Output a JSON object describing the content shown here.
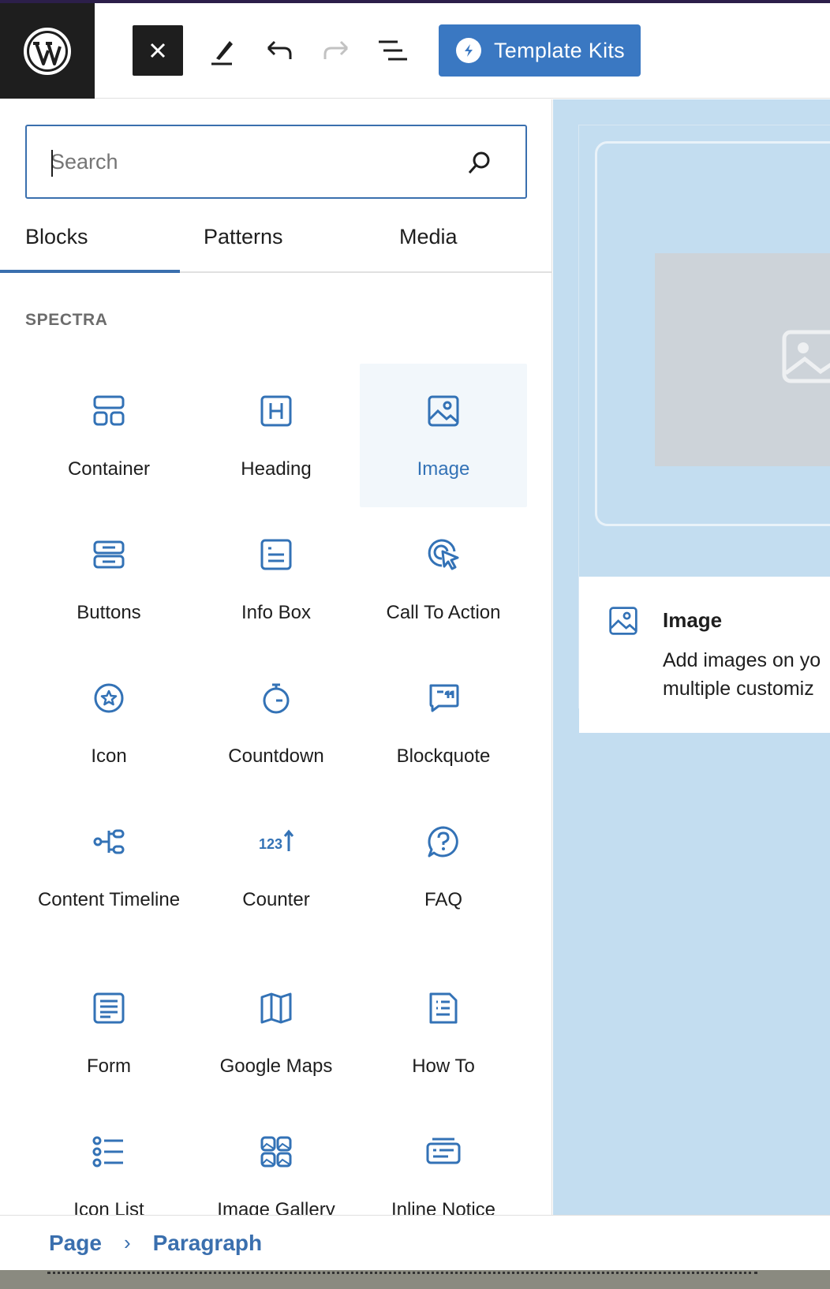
{
  "toolbar": {
    "template_kits_label": "Template Kits"
  },
  "search": {
    "placeholder": "Search",
    "value": ""
  },
  "tabs": [
    {
      "label": "Blocks",
      "active": true
    },
    {
      "label": "Patterns",
      "active": false
    },
    {
      "label": "Media",
      "active": false
    }
  ],
  "category": {
    "title": "SPECTRA"
  },
  "blocks": [
    {
      "label": "Container",
      "icon": "container-icon"
    },
    {
      "label": "Heading",
      "icon": "heading-icon"
    },
    {
      "label": "Image",
      "icon": "image-icon",
      "selected": true
    },
    {
      "label": "Buttons",
      "icon": "buttons-icon"
    },
    {
      "label": "Info Box",
      "icon": "info-box-icon"
    },
    {
      "label": "Call To Action",
      "icon": "call-to-action-icon"
    },
    {
      "label": "Icon",
      "icon": "star-circle-icon"
    },
    {
      "label": "Countdown",
      "icon": "stopwatch-icon"
    },
    {
      "label": "Blockquote",
      "icon": "quote-bubble-icon"
    },
    {
      "label": "Content Timeline",
      "icon": "timeline-icon"
    },
    {
      "label": "Counter",
      "icon": "counter-icon"
    },
    {
      "label": "FAQ",
      "icon": "question-bubble-icon"
    },
    {
      "label": "Form",
      "icon": "form-icon"
    },
    {
      "label": "Google Maps",
      "icon": "map-icon"
    },
    {
      "label": "How To",
      "icon": "how-to-icon"
    },
    {
      "label": "Icon List",
      "icon": "icon-list-icon"
    },
    {
      "label": "Image Gallery",
      "icon": "image-gallery-icon"
    },
    {
      "label": "Inline Notice",
      "icon": "inline-notice-icon"
    }
  ],
  "preview": {
    "title": "Image",
    "description_line1": "Add images on yo",
    "description_line2": "multiple customiz"
  },
  "breadcrumb": {
    "items": [
      "Page",
      "Paragraph"
    ],
    "separator": "›"
  },
  "colors": {
    "accent": "#3a6fae",
    "template_kits_bg": "#3a78c2",
    "canvas_bg": "#c3ddf0",
    "selected_block_bg": "#f2f7fb"
  }
}
